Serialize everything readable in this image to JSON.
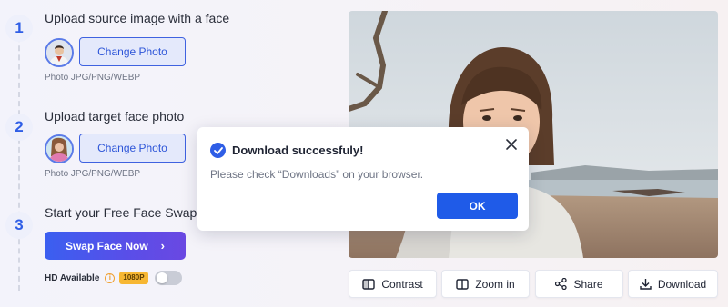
{
  "steps": [
    {
      "number": "1",
      "title": "Upload source image with a face",
      "button_label": "Change Photo",
      "hint": "Photo JPG/PNG/WEBP",
      "thumb_icon": "source-face-thumbnail"
    },
    {
      "number": "2",
      "title": "Upload target face photo",
      "button_label": "Change Photo",
      "hint": "Photo JPG/PNG/WEBP",
      "thumb_icon": "target-face-thumbnail"
    },
    {
      "number": "3",
      "title": "Start your Free Face Swap",
      "button_label": "Swap Face Now",
      "button_icon": "chevron-right-icon"
    }
  ],
  "hd": {
    "label": "HD Available",
    "info_icon": "info-icon",
    "badge": "1080P",
    "toggle_on": false
  },
  "toolbar": [
    {
      "label": "Contrast",
      "icon": "contrast-icon"
    },
    {
      "label": "Zoom in",
      "icon": "zoom-in-icon"
    },
    {
      "label": "Share",
      "icon": "share-icon"
    },
    {
      "label": "Download",
      "icon": "download-icon"
    }
  ],
  "modal": {
    "title": "Download successfuly!",
    "message": "Please check “Downloads” on your browser.",
    "ok_label": "OK",
    "status_icon": "check-circle-icon",
    "close_icon": "close-icon"
  },
  "colors": {
    "accent": "#2f5ee6",
    "badge": "#f7b733",
    "info": "#f0a030"
  }
}
